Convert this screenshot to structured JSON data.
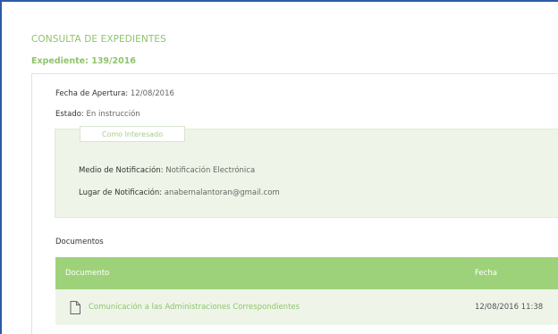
{
  "page": {
    "section_title": "CONSULTA DE EXPEDIENTES",
    "expediente_label": "Expediente: 139/2016"
  },
  "details": {
    "fecha_apertura_label": "Fecha de Apertura:",
    "fecha_apertura_value": "12/08/2016",
    "estado_label": "Estado:",
    "estado_value": "En instrucción"
  },
  "interesado": {
    "tab_label": "Como Interesado",
    "medio_label": "Medio de Notificación:",
    "medio_value": "Notificación Electrónica",
    "lugar_label": "Lugar de Notificación:",
    "lugar_value": "anabernalantoran@gmail.com"
  },
  "documents": {
    "heading": "Documentos",
    "columns": [
      "Documento",
      "Fecha"
    ],
    "rows": [
      {
        "icon": "document-icon",
        "name": "Comunicación a las Administraciones Correspondientes",
        "date": "12/08/2016 11:38"
      }
    ]
  },
  "colors": {
    "accent_green": "#8fc46b",
    "header_green": "#9ed27a",
    "panel_bg": "#eef5e8",
    "frame_border": "#2d5aa8"
  }
}
